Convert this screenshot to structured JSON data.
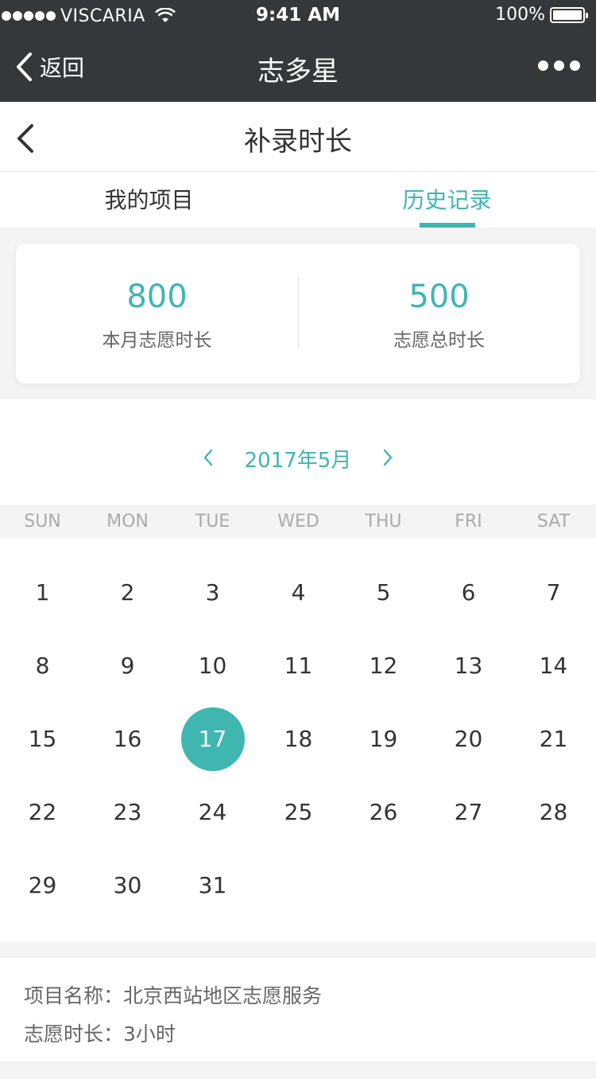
{
  "status_bar": {
    "carrier": "VISCARIA",
    "time": "9:41 AM",
    "battery": "100%"
  },
  "nav": {
    "back_label": "返回",
    "title": "志多星"
  },
  "page": {
    "title": "补录时长"
  },
  "tabs": [
    {
      "label": "我的项目",
      "active": false
    },
    {
      "label": "历史记录",
      "active": true
    }
  ],
  "summary": {
    "month": {
      "value": "800",
      "label": "本月志愿时长"
    },
    "total": {
      "value": "500",
      "label": "志愿总时长"
    }
  },
  "calendar": {
    "month_label": "2017年5月",
    "weekdays": [
      "SUN",
      "MON",
      "TUE",
      "WED",
      "THU",
      "FRI",
      "SAT"
    ],
    "days": [
      "1",
      "2",
      "3",
      "4",
      "5",
      "6",
      "7",
      "8",
      "9",
      "10",
      "11",
      "12",
      "13",
      "14",
      "15",
      "16",
      "17",
      "18",
      "19",
      "20",
      "21",
      "22",
      "23",
      "24",
      "25",
      "26",
      "27",
      "28",
      "29",
      "30",
      "31"
    ],
    "selected_day": "17"
  },
  "detail": {
    "project_label": "项目名称：",
    "project_value": "北京西站地区志愿服务",
    "duration_label": "志愿时长：",
    "duration_value": "3小时"
  },
  "colors": {
    "accent": "#3fb6b0",
    "nav_bg": "#36373a"
  }
}
